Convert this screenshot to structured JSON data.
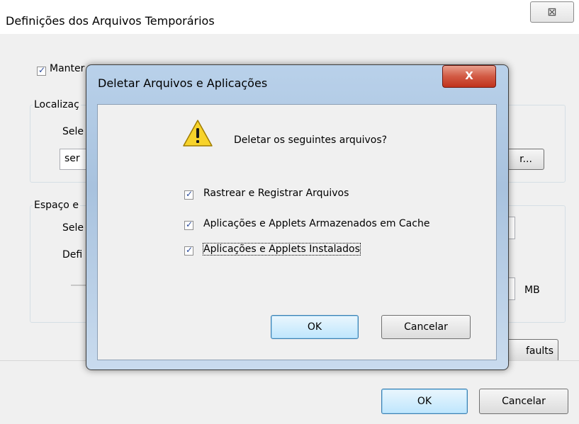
{
  "outer_window": {
    "title": "Definições dos Arquivos Temporários",
    "close_glyph": "⊠",
    "keep_label": "Manter",
    "location_group_label": "Localizaç",
    "select_label_1": "Sele",
    "path_text": "ser",
    "browse_partial": "r...",
    "disk_group_label": "Espaço e",
    "select_label_2": "Sele",
    "define_label": "Defi",
    "unit_label": "MB",
    "defaults_partial": "faults",
    "ok_label": "OK",
    "cancel_label": "Cancelar"
  },
  "dialog": {
    "title": "Deletar Arquivos e Aplicações",
    "close_glyph": "X",
    "icon": "warning-icon",
    "message": "Deletar os seguintes arquivos?",
    "options": [
      {
        "label": "Rastrear e Registrar Arquivos",
        "checked": true
      },
      {
        "label": "Aplicações e Applets Armazenados em Cache",
        "checked": true
      },
      {
        "label": "Aplicações e Applets Instalados",
        "checked": true
      }
    ],
    "ok_label": "OK",
    "cancel_label": "Cancelar"
  },
  "colors": {
    "accent_blue": "#3c7fb1",
    "close_red": "#c0321c",
    "warning_yellow": "#f7d32b"
  }
}
